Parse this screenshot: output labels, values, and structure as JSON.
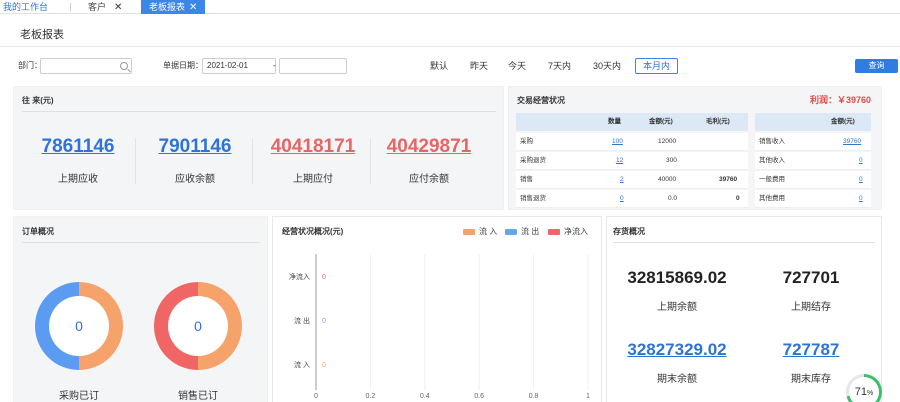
{
  "tabs": [
    {
      "label": "我的工作台",
      "closable": false
    },
    {
      "label": "客户",
      "closable": true
    },
    {
      "label": "老板报表",
      "closable": true,
      "active": true
    }
  ],
  "page_title": "老板报表",
  "filters": {
    "dept_label": "部门：",
    "dept_value": "",
    "date_label": "单据日期：",
    "date_from": "2021-02-01",
    "date_sep": "-",
    "date_to": "",
    "quick": [
      "默认",
      "昨天",
      "今天",
      "7天内",
      "30天内",
      "本月内"
    ],
    "quick_selected": "本月内",
    "query": "查询"
  },
  "accounts": {
    "title": "往 来(元)",
    "items": [
      {
        "value": "7861146",
        "label": "上期应收",
        "color": "blue"
      },
      {
        "value": "7901146",
        "label": "应收余额",
        "color": "blue"
      },
      {
        "value": "40418171",
        "label": "上期应付",
        "color": "red"
      },
      {
        "value": "40429871",
        "label": "应付余额",
        "color": "red"
      }
    ]
  },
  "trade": {
    "title": "交易经营状况",
    "profit": "利润：￥39760",
    "left_headers": [
      "",
      "数量",
      "金额(元)",
      "毛利(元)"
    ],
    "left_rows": [
      {
        "name": "采购",
        "qty": "100",
        "amount": "12000",
        "profit": ""
      },
      {
        "name": "采购退货",
        "qty": "12",
        "amount": "300",
        "profit": ""
      },
      {
        "name": "销售",
        "qty": "2",
        "amount": "40000",
        "profit": "39760"
      },
      {
        "name": "销售退货",
        "qty": "0",
        "amount": "0.0",
        "profit": "0"
      }
    ],
    "right_headers": [
      "",
      "金额(元)"
    ],
    "right_rows": [
      {
        "name": "销售收入",
        "amount": "39760"
      },
      {
        "name": "其他收入",
        "amount": "0"
      },
      {
        "name": "一般费用",
        "amount": "0"
      },
      {
        "name": "其他费用",
        "amount": "0"
      }
    ]
  },
  "orders": {
    "title": "订单概况",
    "items": [
      {
        "value": "0",
        "label": "采购已订"
      },
      {
        "value": "0",
        "label": "销售已订"
      }
    ],
    "colors": {
      "orange": "#f6a26b",
      "blue": "#5b9cf2",
      "red": "#f06565"
    }
  },
  "ops": {
    "title": "经营状况概况(元)",
    "legend": [
      {
        "name": "流 入",
        "color": "#f6a26b"
      },
      {
        "name": "流 出",
        "color": "#6aa5f0"
      },
      {
        "name": "净流入",
        "color": "#f06565"
      }
    ]
  },
  "chart_data": {
    "type": "bar",
    "orientation": "horizontal",
    "categories": [
      "净流入",
      "流  出",
      "流  入"
    ],
    "series": [
      {
        "name": "净流入",
        "values": [
          0,
          null,
          null
        ],
        "color": "#f06565"
      },
      {
        "name": "流 出",
        "values": [
          null,
          0,
          null
        ],
        "color": "#6aa5f0"
      },
      {
        "name": "流 入",
        "values": [
          null,
          null,
          0
        ],
        "color": "#f6a26b"
      }
    ],
    "data_labels": [
      "0",
      "0",
      "0"
    ],
    "xticks": [
      "0",
      "0.2",
      "0.4",
      "0.6",
      "0.8",
      "1"
    ],
    "xlim": [
      0,
      1
    ],
    "legend_position": "top-right"
  },
  "stock": {
    "title": "存货概况",
    "items": [
      {
        "value": "32815869.02",
        "label": "上期余额",
        "link": false
      },
      {
        "value": "727701",
        "label": "上期结存",
        "link": false
      },
      {
        "value": "32827329.02",
        "label": "期末余额",
        "link": true
      },
      {
        "value": "727787",
        "label": "期末库存",
        "link": true
      }
    ]
  },
  "progress": {
    "value": "71",
    "unit": "%"
  }
}
